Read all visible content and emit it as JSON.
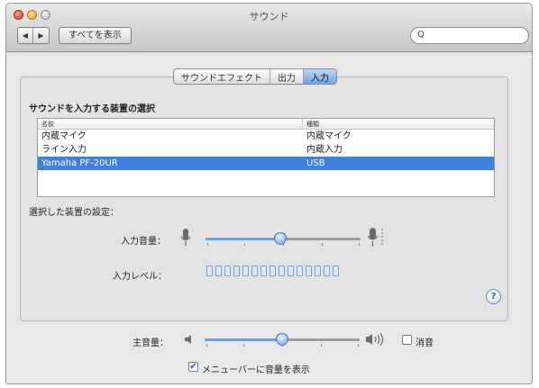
{
  "window": {
    "title": "サウンド",
    "show_all": "すべてを表示",
    "nav_back": "◀",
    "nav_forward": "▶"
  },
  "search": {
    "icon": "search-icon",
    "glyph": "Q"
  },
  "tabs": [
    {
      "label": "サウンドエフェクト",
      "active": false
    },
    {
      "label": "出力",
      "active": false
    },
    {
      "label": "入力",
      "active": true
    }
  ],
  "input": {
    "section_title": "サウンドを入力する装置の選択",
    "columns": [
      "名前",
      "種類"
    ],
    "devices": [
      {
        "name": "内蔵マイク",
        "type": "内蔵マイク",
        "selected": false
      },
      {
        "name": "ライン入力",
        "type": "内蔵入力",
        "selected": false
      },
      {
        "name": "Yamaha PF-20UR",
        "type": "USB",
        "selected": true
      }
    ],
    "settings_label": "選択した装置の設定：",
    "volume_label": "入力音量：",
    "volume_level": 0.48,
    "level_label": "入力レベル：",
    "level_cells": 15
  },
  "output": {
    "volume_label": "主音量：",
    "volume_level": 0.5,
    "mute_label": "消音",
    "mute_checked": false,
    "menubar_label": "メニューバーに音量を表示",
    "menubar_checked": true,
    "check_glyph": "✔"
  },
  "help": {
    "glyph": "?"
  },
  "colors": {
    "accent": "#3d80df",
    "selected_row": "#3d80df",
    "slider_fill": "#6d9fdc"
  }
}
